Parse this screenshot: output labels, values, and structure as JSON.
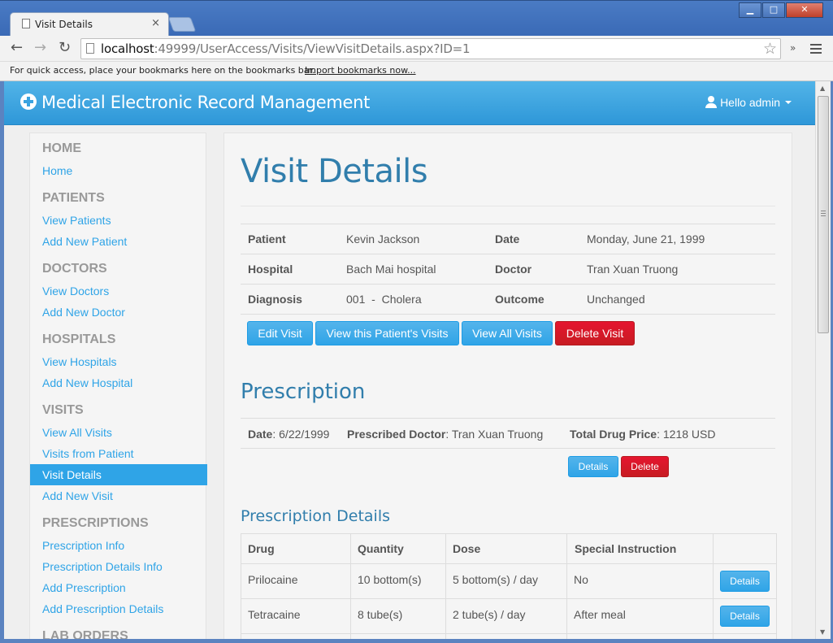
{
  "browser": {
    "tab_title": "Visit Details",
    "tab_close": "×",
    "url_host": "localhost",
    "url_rest": ":49999/UserAccess/Visits/ViewVisitDetails.aspx?ID=1",
    "bookmark_message": "For quick access, place your bookmarks here on the bookmarks bar.",
    "bookmark_link": "Import bookmarks now...",
    "nav_back": "←",
    "nav_forward": "→",
    "nav_reload": "↻",
    "star": "☆",
    "chevron": "»",
    "win_min": "▁",
    "win_max": "□",
    "win_close": "✕"
  },
  "app": {
    "brand": "Medical Electronic Record Management",
    "user_menu": "Hello admin"
  },
  "sidebar": {
    "home_header": "HOME",
    "home": "Home",
    "patients_header": "PATIENTS",
    "view_patients": "View Patients",
    "add_patient": "Add New Patient",
    "doctors_header": "DOCTORS",
    "view_doctors": "View Doctors",
    "add_doctor": "Add New Doctor",
    "hospitals_header": "HOSPITALS",
    "view_hospitals": "View Hospitals",
    "add_hospital": "Add New Hospital",
    "visits_header": "VISITS",
    "view_all_visits": "View All Visits",
    "visits_from_patient": "Visits from Patient",
    "visit_details": "Visit Details",
    "add_visit": "Add New Visit",
    "prescriptions_header": "PRESCRIPTIONS",
    "prescription_info": "Prescription Info",
    "prescription_details_info": "Prescription Details Info",
    "add_prescription": "Add Prescription",
    "add_prescription_details": "Add Prescription Details",
    "lab_orders_header": "LAB ORDERS"
  },
  "visit": {
    "title": "Visit Details",
    "patient_label": "Patient",
    "patient": "Kevin Jackson",
    "date_label": "Date",
    "date": "Monday, June 21, 1999",
    "hospital_label": "Hospital",
    "hospital": "Bach Mai hospital",
    "doctor_label": "Doctor",
    "doctor": "Tran Xuan Truong",
    "diagnosis_label": "Diagnosis",
    "diagnosis": "001  -  Cholera",
    "outcome_label": "Outcome",
    "outcome": "Unchanged",
    "buttons": {
      "edit": "Edit Visit",
      "patient_visits": "View this Patient's Visits",
      "all_visits": "View All Visits",
      "delete": "Delete Visit"
    }
  },
  "prescription": {
    "title": "Prescription",
    "date_label": "Date",
    "date": ": 6/22/1999",
    "doctor_label": "Prescribed Doctor",
    "doctor": ": Tran Xuan Truong",
    "price_label": "Total Drug Price",
    "price": ": 1218 USD",
    "details_btn": "Details",
    "delete_btn": "Delete"
  },
  "prescription_details": {
    "title": "Prescription Details",
    "columns": [
      "Drug",
      "Quantity",
      "Dose",
      "Special Instruction"
    ],
    "rows": [
      {
        "drug": "Prilocaine",
        "quantity": "10 bottom(s)",
        "dose": "5 bottom(s) / day",
        "instruction": "No",
        "action": "Details"
      },
      {
        "drug": "Tetracaine",
        "quantity": "8 tube(s)",
        "dose": "2 tube(s) / day",
        "instruction": "After meal",
        "action": "Details"
      }
    ]
  }
}
